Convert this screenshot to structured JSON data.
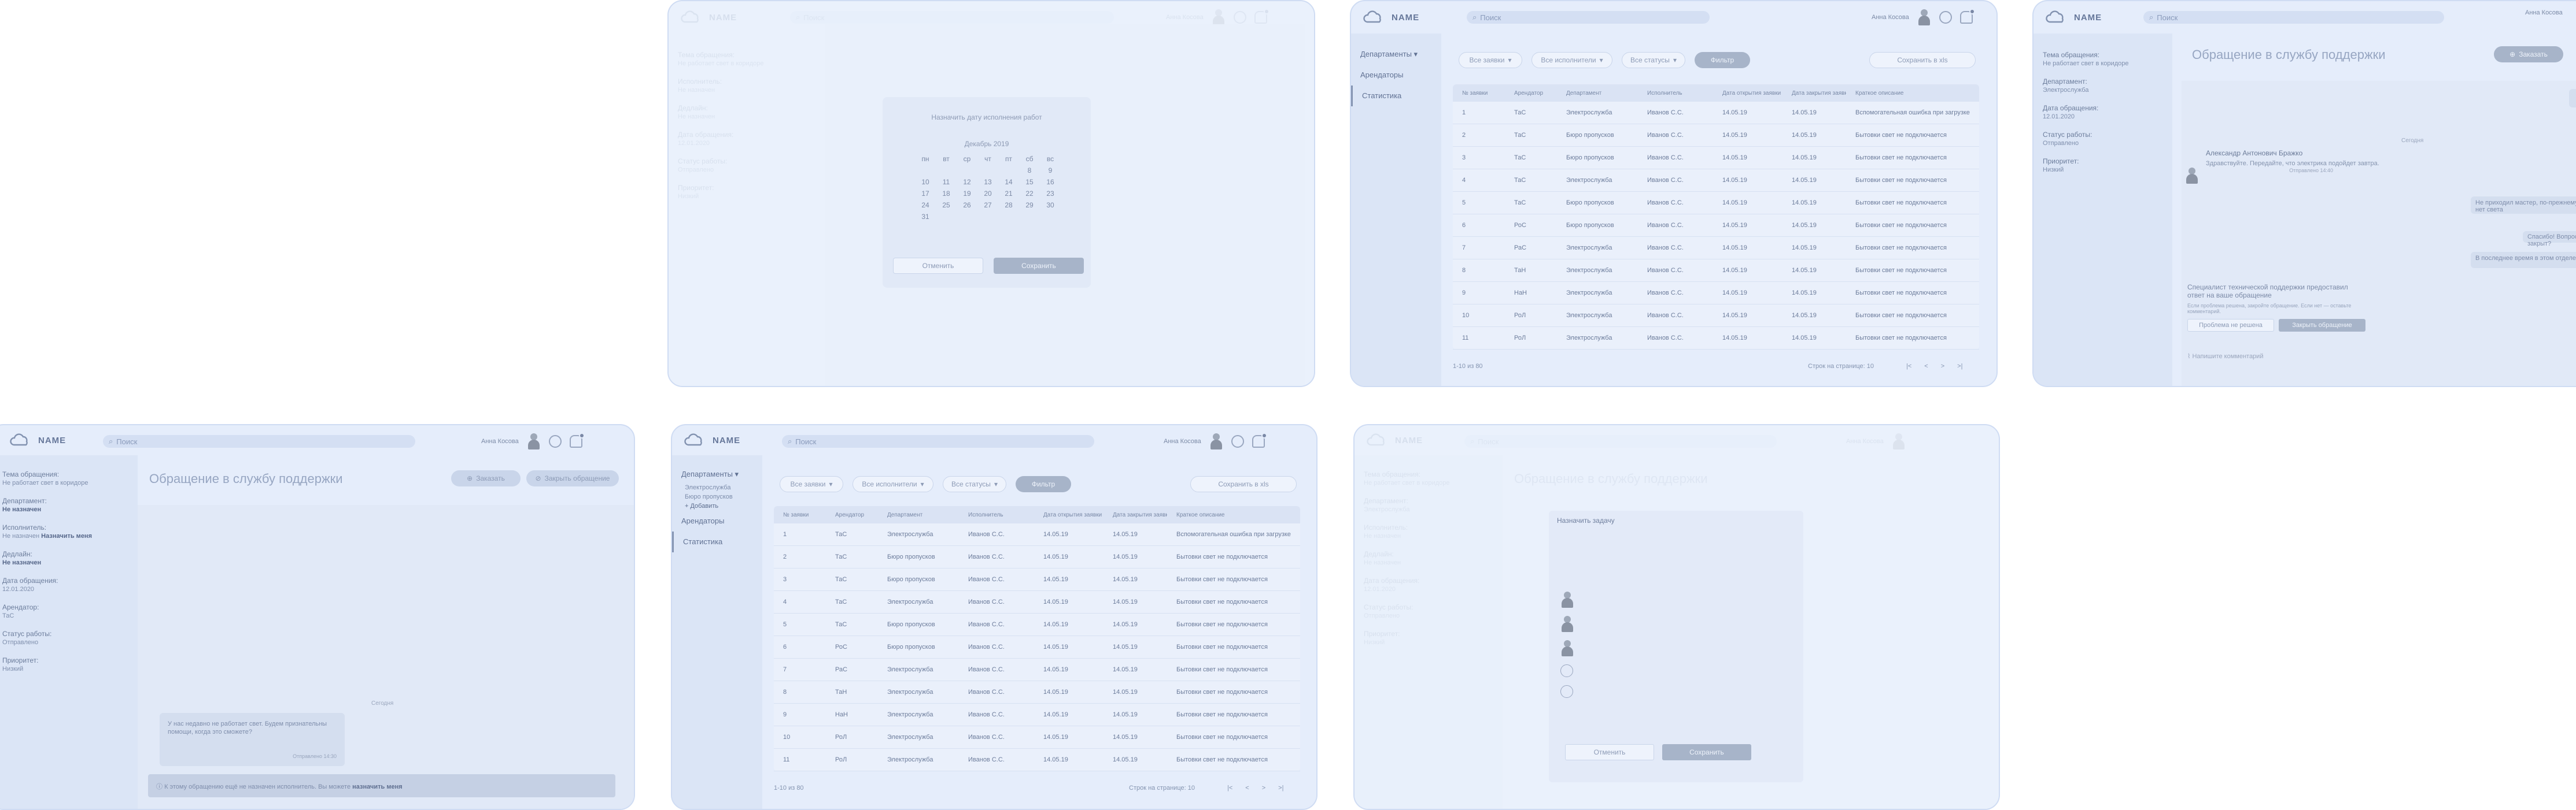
{
  "app": {
    "logo_text": "NAME",
    "search_placeholder": "Поиск",
    "user_name": "Анна Косова"
  },
  "request_fields": {
    "topic_label": "Тема обращения:",
    "topic_value": "Не работает свет в коридоре",
    "dept_label": "Департамент:",
    "dept_value": "Не назначен",
    "executor_label": "Исполнитель:",
    "executor_value": "Не назначен",
    "assign_label": "Назначить меня",
    "deadline_label": "Дедлайн:",
    "deadline_value": "Не назначен",
    "date_label": "Дата обращения:",
    "date_value": "12.01.2020",
    "tenant_label": "Арендатор:",
    "tenant_value": "ТаС",
    "status_label": "Статус работы:",
    "status_value": "Отправлено",
    "priority_label": "Приоритет:",
    "priority_value": "Низкий"
  },
  "support": {
    "title": "Обращение в службу поддержки",
    "take_label": "Заказать",
    "close_label": "Закрыть обращение",
    "today_label": "Сегодня",
    "client_message": "У нас недавно не работает свет. Будем признательны помощи, когда это сможете?",
    "message_time": "Отправлено 14:30",
    "banner_text": "К этому обращению ещё не назначен исполнитель. Вы можете",
    "banner_link": "назначить меня",
    "agent_name": "Александр Антонович Бражко",
    "agent_msg": "Здравствуйте. Передайте, что электрика подойдет завтра.",
    "agent_time": "Отправлено 14:40",
    "right_msg1": "Спасибо! Вопрос закрыт?",
    "right_msg2": "Не приходил мастер, по-прежнему нет света",
    "right_msg3": "В последнее время в этом отделе",
    "close_question": "Специалист технической поддержки предоставил ответ на ваше обращение",
    "close_note": "Если проблема решена, закройте обращение. Если нет — оставьте комментарий.",
    "not_solved_label": "Проблема не решена",
    "close_btn_label": "Закрыть обращение",
    "comment_placeholder": "Напишите комментарий"
  },
  "calendar": {
    "title": "Назначить дату исполнения работ",
    "month": "Декабрь 2019",
    "weekdays": [
      "пн",
      "вт",
      "ср",
      "чт",
      "пт",
      "сб",
      "вс"
    ],
    "days": [
      "",
      "",
      "",
      "",
      "",
      "8",
      "9",
      "10",
      "11",
      "12",
      "13",
      "14",
      "15",
      "16",
      "17",
      "18",
      "19",
      "20",
      "21",
      "22",
      "23",
      "24",
      "25",
      "26",
      "27",
      "28",
      "29",
      "30",
      "31",
      "",
      "",
      "",
      "",
      "",
      ""
    ],
    "cancel_label": "Отменить",
    "save_label": "Сохранить"
  },
  "assign_modal": {
    "title": "Назначить задачу",
    "cancel_label": "Отменить",
    "save_label": "Сохранить"
  },
  "nav": {
    "dept_label": "Департаменты",
    "dept_sub1": "Электрослужба",
    "dept_sub2": "Бюро пропусков",
    "add_label": "+ Добавить",
    "tenants_label": "Арендаторы",
    "stats_label": "Статистика"
  },
  "filters": {
    "all_requests": "Все заявки",
    "all_executors": "Все исполнители",
    "all_statuses": "Все статусы",
    "apply": "Фильтр",
    "export": "Сохранить в xls"
  },
  "table": {
    "headers": [
      "№ заявки",
      "Арендатор",
      "Департамент",
      "Исполнитель",
      "Дата открытия заявки",
      "Дата закрытия заявки",
      "Краткое описание"
    ],
    "rows": [
      [
        "1",
        "ТаС",
        "Электрослужба",
        "Иванов С.С.",
        "14.05.19",
        "14.05.19",
        "Вспомогательная ошибка при загрузке"
      ],
      [
        "2",
        "ТаС",
        "Бюро пропусков",
        "Иванов С.С.",
        "14.05.19",
        "14.05.19",
        "Бытовки свет не подключается"
      ],
      [
        "3",
        "ТаС",
        "Бюро пропусков",
        "Иванов С.С.",
        "14.05.19",
        "14.05.19",
        "Бытовки свет не подключается"
      ],
      [
        "4",
        "ТаС",
        "Электрослужба",
        "Иванов С.С.",
        "14.05.19",
        "14.05.19",
        "Бытовки свет не подключается"
      ],
      [
        "5",
        "ТаС",
        "Бюро пропусков",
        "Иванов С.С.",
        "14.05.19",
        "14.05.19",
        "Бытовки свет не подключается"
      ],
      [
        "6",
        "РоС",
        "Бюро пропусков",
        "Иванов С.С.",
        "14.05.19",
        "14.05.19",
        "Бытовки свет не подключается"
      ],
      [
        "7",
        "РаС",
        "Электрослужба",
        "Иванов С.С.",
        "14.05.19",
        "14.05.19",
        "Бытовки свет не подключается"
      ],
      [
        "8",
        "ТаН",
        "Электрослужба",
        "Иванов С.С.",
        "14.05.19",
        "14.05.19",
        "Бытовки свет не подключается"
      ],
      [
        "9",
        "НаН",
        "Электрослужба",
        "Иванов С.С.",
        "14.05.19",
        "14.05.19",
        "Бытовки свет не подключается"
      ],
      [
        "10",
        "РоЛ",
        "Электрослужба",
        "Иванов С.С.",
        "14.05.19",
        "14.05.19",
        "Бытовки свет не подключается"
      ],
      [
        "11",
        "РоЛ",
        "Электрослужба",
        "Иванов С.С.",
        "14.05.19",
        "14.05.19",
        "Бытовки свет не подключается"
      ]
    ],
    "footer_left": "1-10 из 80",
    "footer_right": "Строк на странице: 10",
    "pager": [
      "|<",
      "<",
      ">",
      ">|"
    ]
  },
  "colors": {
    "bg": "#e5edfb",
    "sidebar": "#dbe5f6",
    "accent": "#a7b4c9"
  }
}
